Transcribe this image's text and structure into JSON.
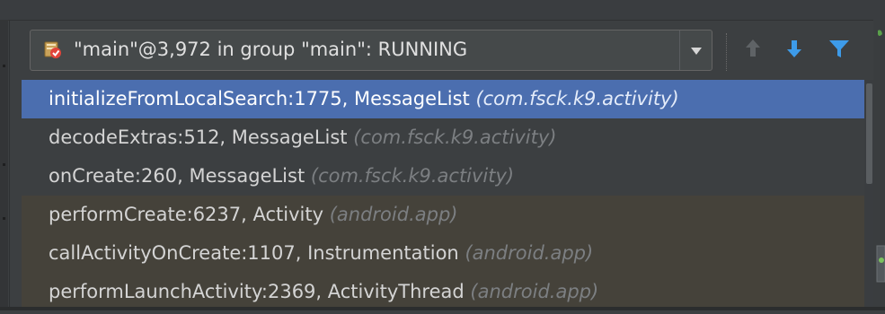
{
  "thread_selector": {
    "label": "\"main\"@3,972 in group \"main\": RUNNING",
    "icon": "thread-running-icon"
  },
  "toolbar": {
    "icons": [
      "up-arrow-icon",
      "down-arrow-icon",
      "filter-icon"
    ]
  },
  "frames": [
    {
      "method": "initializeFromLocalSearch:1775, MessageList",
      "package": "(com.fsck.k9.activity)",
      "selected": true,
      "library": false
    },
    {
      "method": "decodeExtras:512, MessageList",
      "package": "(com.fsck.k9.activity)",
      "selected": false,
      "library": false
    },
    {
      "method": "onCreate:260, MessageList",
      "package": "(com.fsck.k9.activity)",
      "selected": false,
      "library": false
    },
    {
      "method": "performCreate:6237, Activity",
      "package": "(android.app)",
      "selected": false,
      "library": true
    },
    {
      "method": "callActivityOnCreate:1107, Instrumentation",
      "package": "(android.app)",
      "selected": false,
      "library": true
    },
    {
      "method": "performLaunchActivity:2369, ActivityThread",
      "package": "(android.app)",
      "selected": false,
      "library": true
    }
  ],
  "colors": {
    "selected_row": "#4b6eaf",
    "library_row": "#45423a",
    "accent_blue": "#3d9be9"
  }
}
